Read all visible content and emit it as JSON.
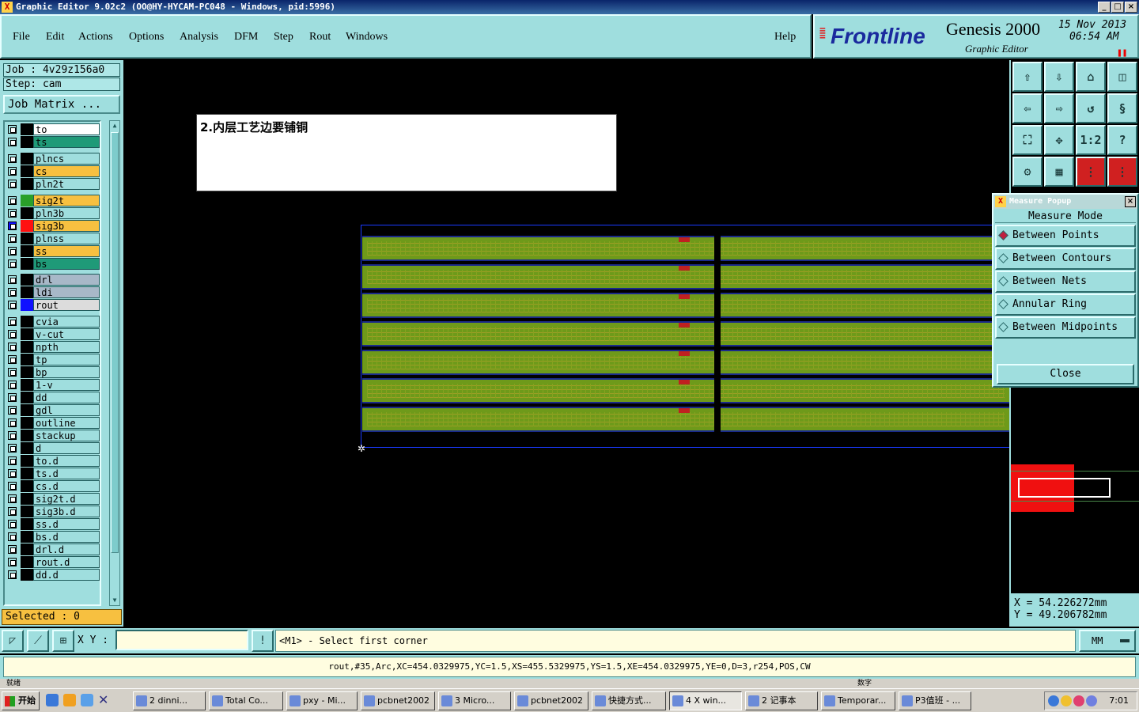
{
  "window": {
    "title": "Graphic Editor 9.02c2  (OO@HY-HYCAM-PC048 - Windows, pid:5996)",
    "icon": "x-app-icon"
  },
  "menu": [
    "File",
    "Edit",
    "Actions",
    "Options",
    "Analysis",
    "DFM",
    "Step",
    "Rout",
    "Windows"
  ],
  "help": "Help",
  "brand": {
    "logo": "Frontline",
    "product": "Genesis 2000",
    "subtitle": "Graphic Editor",
    "date": "15 Nov 2013",
    "time": "06:54 AM"
  },
  "job": {
    "job_line": "Job : 4v29z156a0",
    "step_line": "Step: cam",
    "matrix_button": "Job Matrix ..."
  },
  "layers": [
    {
      "name": "to",
      "swatch": "#000000",
      "bg": "#ffffff"
    },
    {
      "name": "ts",
      "swatch": "#000000",
      "bg": "#1f9a78"
    },
    {
      "name": "plncs",
      "swatch": "#000000",
      "bg": "#9fdede"
    },
    {
      "name": "cs",
      "swatch": "#000000",
      "bg": "#f7c040"
    },
    {
      "name": "pln2t",
      "swatch": "#000000",
      "bg": "#9fdede"
    },
    {
      "name": "sig2t",
      "swatch": "#2aa02a",
      "bg": "#f7c040"
    },
    {
      "name": "pln3b",
      "swatch": "#000000",
      "bg": "#9fdede"
    },
    {
      "name": "sig3b",
      "swatch": "#ff1010",
      "bg": "#f7c040",
      "selected": true
    },
    {
      "name": "plnss",
      "swatch": "#000000",
      "bg": "#9fdede"
    },
    {
      "name": "ss",
      "swatch": "#000000",
      "bg": "#f7c040"
    },
    {
      "name": "bs",
      "swatch": "#000000",
      "bg": "#1f9a78"
    },
    {
      "name": "drl",
      "swatch": "#000000",
      "bg": "#a8b8c8"
    },
    {
      "name": "ldi",
      "swatch": "#000000",
      "bg": "#a8b8c8"
    },
    {
      "name": "rout",
      "swatch": "#1010ff",
      "bg": "#dcdcdc"
    },
    {
      "name": "cvia",
      "swatch": "#000000",
      "bg": "#9fdede"
    },
    {
      "name": "v-cut",
      "swatch": "#000000",
      "bg": "#9fdede"
    },
    {
      "name": "npth",
      "swatch": "#000000",
      "bg": "#9fdede"
    },
    {
      "name": "tp",
      "swatch": "#000000",
      "bg": "#9fdede"
    },
    {
      "name": "bp",
      "swatch": "#000000",
      "bg": "#9fdede"
    },
    {
      "name": "1-v",
      "swatch": "#000000",
      "bg": "#9fdede"
    },
    {
      "name": "dd",
      "swatch": "#000000",
      "bg": "#9fdede"
    },
    {
      "name": "gdl",
      "swatch": "#000000",
      "bg": "#9fdede"
    },
    {
      "name": "outline",
      "swatch": "#000000",
      "bg": "#9fdede"
    },
    {
      "name": "stackup",
      "swatch": "#000000",
      "bg": "#9fdede"
    },
    {
      "name": "d",
      "swatch": "#000000",
      "bg": "#9fdede"
    },
    {
      "name": "to.d",
      "swatch": "#000000",
      "bg": "#9fdede"
    },
    {
      "name": "ts.d",
      "swatch": "#000000",
      "bg": "#9fdede"
    },
    {
      "name": "cs.d",
      "swatch": "#000000",
      "bg": "#9fdede"
    },
    {
      "name": "sig2t.d",
      "swatch": "#000000",
      "bg": "#9fdede"
    },
    {
      "name": "sig3b.d",
      "swatch": "#000000",
      "bg": "#9fdede"
    },
    {
      "name": "ss.d",
      "swatch": "#000000",
      "bg": "#9fdede"
    },
    {
      "name": "bs.d",
      "swatch": "#000000",
      "bg": "#9fdede"
    },
    {
      "name": "drl.d",
      "swatch": "#000000",
      "bg": "#9fdede"
    },
    {
      "name": "rout.d",
      "swatch": "#000000",
      "bg": "#9fdede"
    },
    {
      "name": "dd.d",
      "swatch": "#000000",
      "bg": "#9fdede"
    }
  ],
  "selected_text": "Selected : 0",
  "note": "2.内层工艺边要铺铜",
  "measure_popup": {
    "title": "Measure Popup",
    "mode_label": "Measure Mode",
    "options": [
      "Between Points",
      "Between Contours",
      "Between Nets",
      "Annular Ring",
      "Between Midpoints"
    ],
    "selected_index": 0,
    "close": "Close"
  },
  "coords": {
    "x": "X  =  54.226272mm",
    "y": "Y  =  49.206782mm"
  },
  "command": {
    "xy_label": "X Y :",
    "xy_value": "",
    "prompt": "<M1> - Select first corner",
    "units": "MM"
  },
  "feature_info": "rout,#35,Arc,XC=454.0329975,YC=1.5,XS=455.5329975,YS=1.5,XE=454.0329975,YE=0,D=3,r254,POS,CW",
  "ime_hint": {
    "left": "就绪",
    "right": "数字"
  },
  "taskbar": {
    "start": "开始",
    "tasks": [
      "2 dinni...",
      "Total Co...",
      "pxy - Mi...",
      "pcbnet2002",
      "3 Micro...",
      "pcbnet2002",
      "快捷方式...",
      "4 X win...",
      "2 记事本",
      "Temporar...",
      "P3值班 - ..."
    ],
    "active_index": 7,
    "clock": "7:01"
  },
  "colors": {
    "panel_bg": "#9fdede",
    "canvas_bg": "#000000",
    "pcb_green": "#6e9a1a",
    "rout_blue": "#1a3aff",
    "highlight_red": "#f01010"
  }
}
